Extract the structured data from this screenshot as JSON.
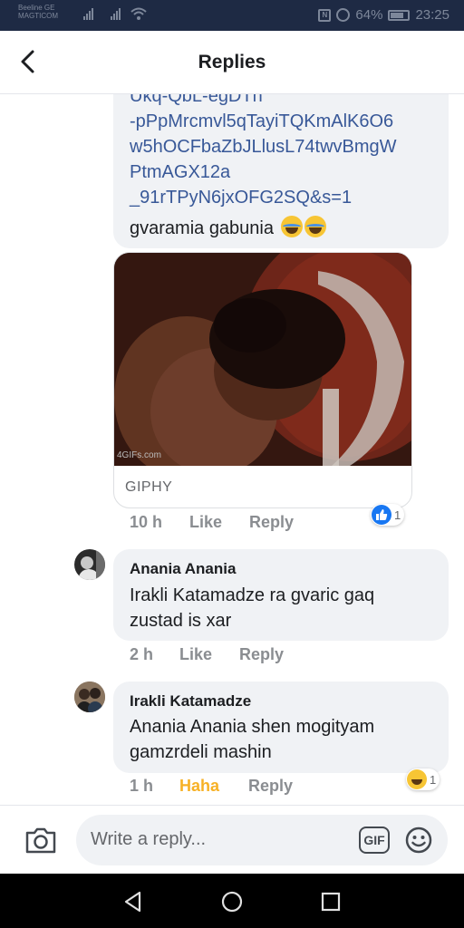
{
  "status_bar": {
    "carrier_line1": "Beeline GE",
    "carrier_line2": "MAGTICOM",
    "battery": "64%",
    "time": "23:25",
    "nfc_icon": "nfc-icon",
    "alarm_icon": "alarm-icon"
  },
  "header": {
    "title": "Replies",
    "back_icon": "chevron-left-icon"
  },
  "comment1": {
    "link_lines": [
      "Ukq-QbL-egDTh",
      "-pPpMrcmvl5qTayiTQKmAlK6O6",
      "w5hOCFbaZbJLlusL74twvBmgW",
      "PtmAGX12a",
      "_91rTPyN6jxOFG2SQ&s=1"
    ],
    "text": "gvaramia gabunia",
    "emoji": "joy-emoji",
    "gif_caption": "GIPHY",
    "gif_watermark": "4GIFs.com",
    "time": "10 h",
    "like": "Like",
    "reply": "Reply",
    "reaction_icon": "like-icon",
    "reaction_count": "1"
  },
  "comment2": {
    "author": "Anania Anania",
    "line1": "Irakli Katamadze ra gvaric gaq",
    "line2": "zustad is xar",
    "time": "2 h",
    "like": "Like",
    "reply": "Reply"
  },
  "comment3": {
    "author": "Irakli Katamadze",
    "line1": "Anania Anania shen mogityam",
    "line2": "gamzrdeli mashin",
    "time": "1 h",
    "like": "Haha",
    "reply": "Reply",
    "reaction_icon": "haha-icon",
    "reaction_count": "1"
  },
  "reply_bar": {
    "placeholder": "Write a reply...",
    "gif_label": "GIF",
    "camera_icon": "camera-icon",
    "emoji_icon": "smiley-icon"
  },
  "colors": {
    "link": "#385898",
    "bubble": "#f0f2f5",
    "meta": "#8a8d91",
    "haha": "#f7b125",
    "status_bar": "#1e2a44"
  }
}
